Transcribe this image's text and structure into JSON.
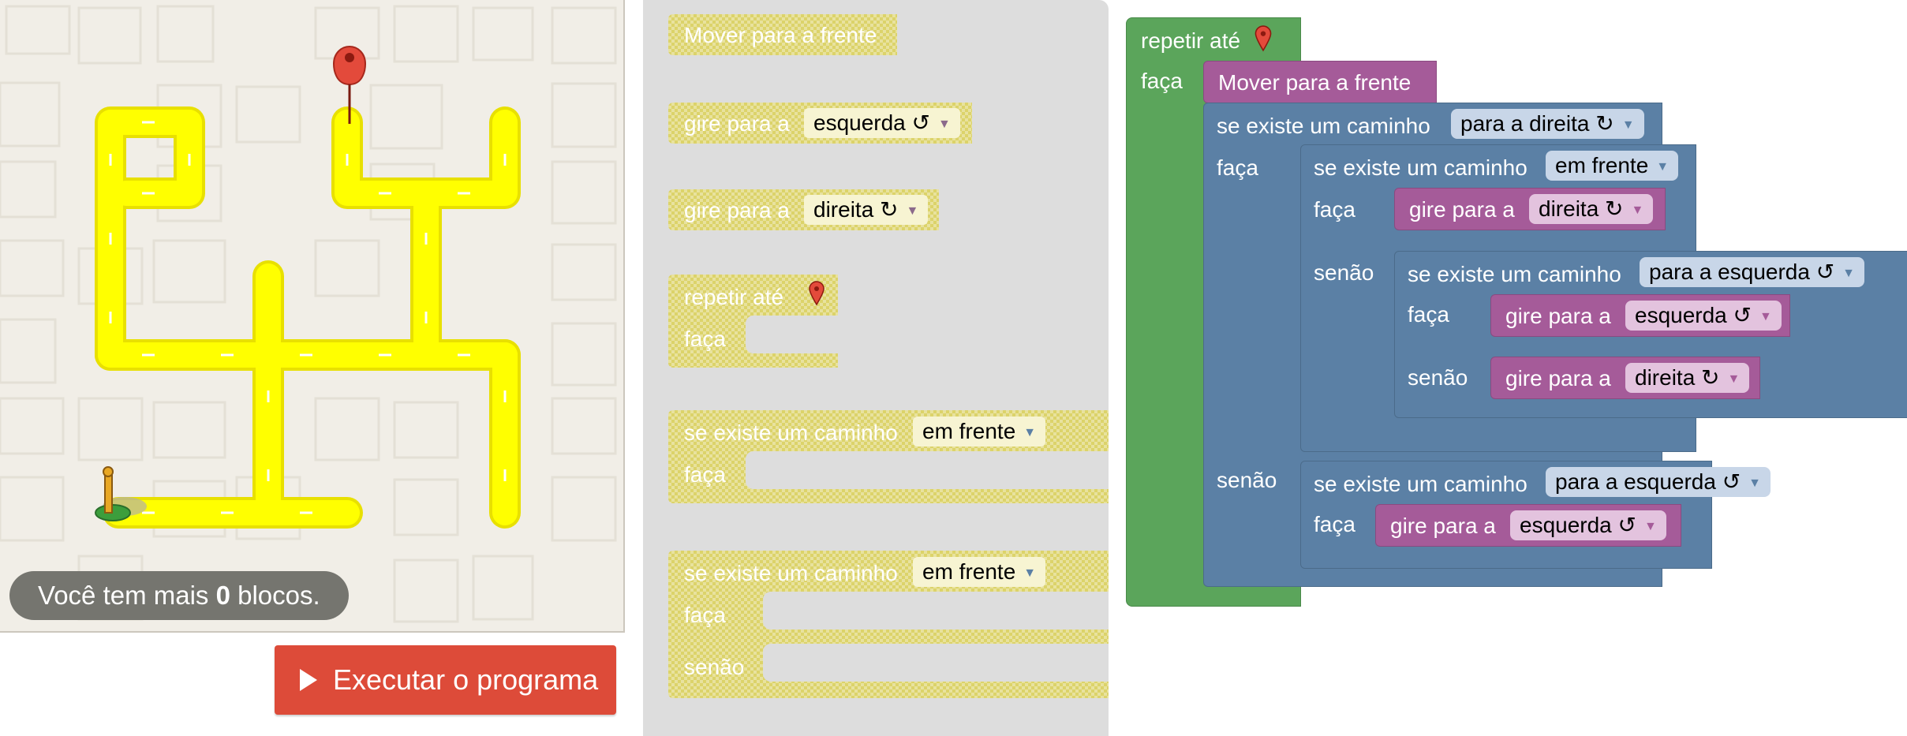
{
  "maze": {
    "capacity_prefix": "Você tem mais ",
    "capacity_count": "0",
    "capacity_suffix": " blocos.",
    "path_color": "#ffff00",
    "icons": [
      "goal-marker-icon",
      "pegman-start-icon"
    ]
  },
  "run_button": {
    "label": "Executar o programa"
  },
  "toolbox": {
    "move_forward": "Mover para a frente",
    "turn_left": {
      "label": "gire para a",
      "option": "esquerda ↺"
    },
    "turn_right": {
      "label": "gire para a",
      "option": "direita ↻"
    },
    "repeat": {
      "label": "repetir até",
      "do": "faça"
    },
    "if_path": {
      "label": "se existe um caminho",
      "option": "em frente",
      "do": "faça"
    },
    "if_else_path": {
      "label": "se existe um caminho",
      "option": "em frente",
      "do": "faça",
      "else": "senão"
    }
  },
  "workspace": {
    "repeat_label": "repetir até",
    "repeat_do": "faça",
    "move_forward": "Mover para a frente",
    "if1": {
      "label": "se existe um caminho",
      "option": "para a direita ↻",
      "do": "faça",
      "else": "senão"
    },
    "if2": {
      "label": "se existe um caminho",
      "option": "em frente",
      "do": "faça",
      "else": "senão"
    },
    "turn1": {
      "label": "gire para a",
      "option": "direita ↻"
    },
    "if3": {
      "label": "se existe um caminho",
      "option": "para a esquerda ↺",
      "do": "faça",
      "else": "senão"
    },
    "turn2": {
      "label": "gire para a",
      "option": "esquerda ↺"
    },
    "turn3": {
      "label": "gire para a",
      "option": "direita ↻"
    },
    "if4": {
      "label": "se existe um caminho",
      "option": "para a esquerda ↺",
      "do": "faça"
    },
    "turn4": {
      "label": "gire para a",
      "option": "esquerda ↺"
    }
  },
  "colors": {
    "loop_green": "#5ba55b",
    "logic_blue": "#5b80a5",
    "movement_purple": "#a55b99",
    "toolbox_yellow": "#dcd36a",
    "run_red": "#dd4b39"
  }
}
